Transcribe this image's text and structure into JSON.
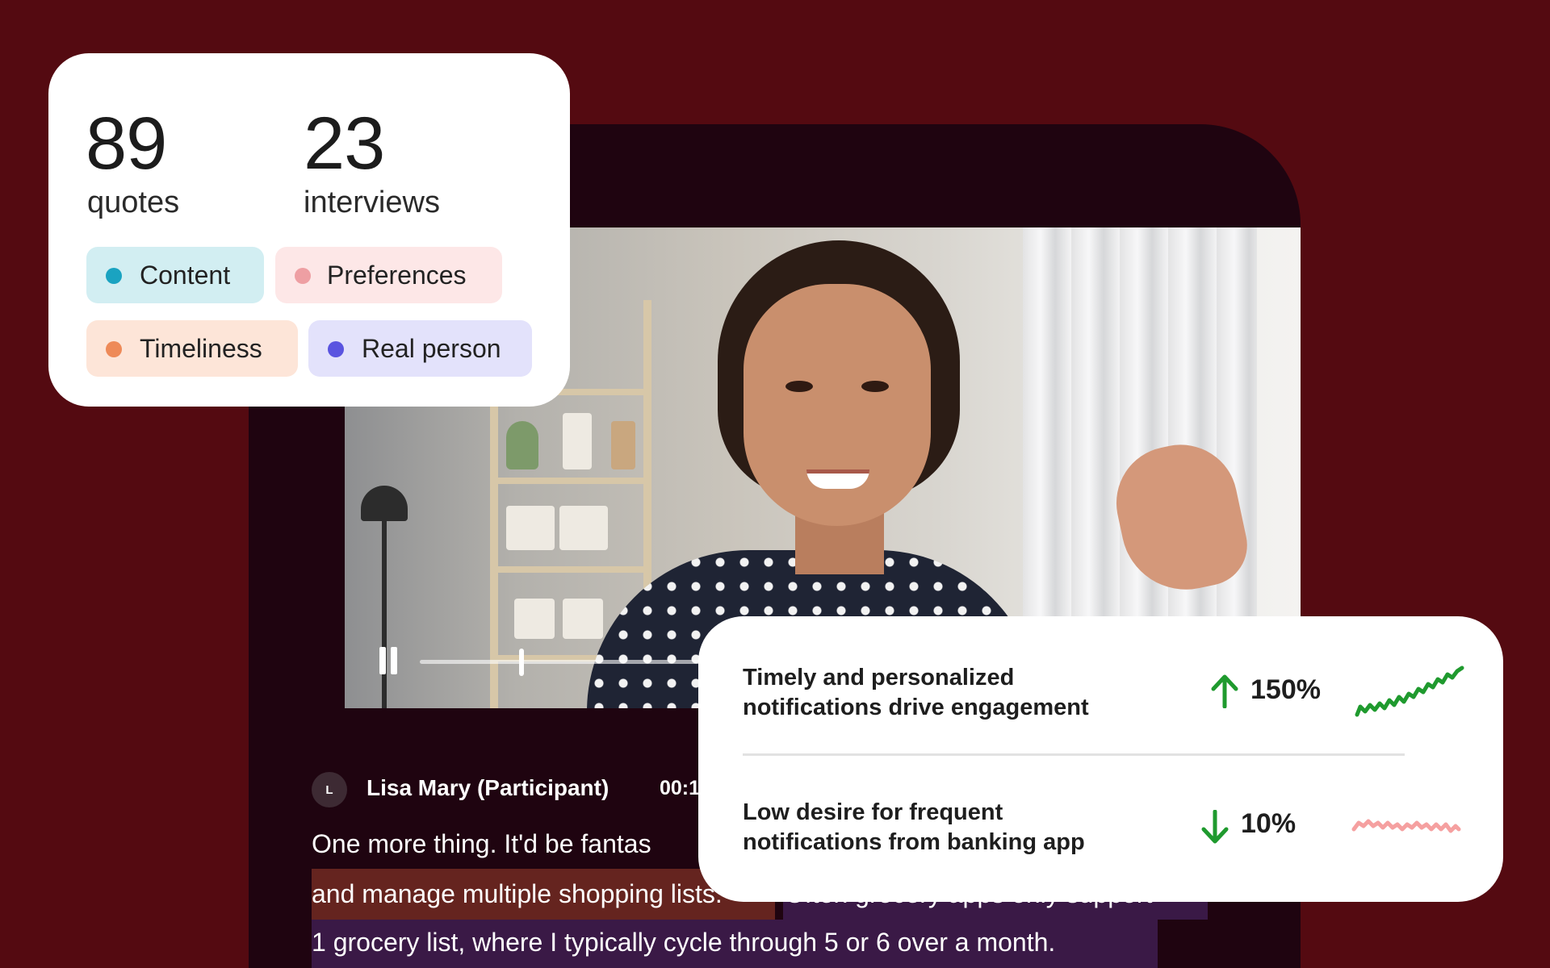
{
  "stats": {
    "quotes_count": "89",
    "quotes_label": "quotes",
    "interviews_count": "23",
    "interviews_label": "interviews"
  },
  "tags": [
    {
      "label": "Content",
      "bg": "#d2eef2",
      "dot": "#1aa3c1"
    },
    {
      "label": "Preferences",
      "bg": "#fde7e7",
      "dot": "#ee9fa3"
    },
    {
      "label": "Timeliness",
      "bg": "#fde5d8",
      "dot": "#ee8a58"
    },
    {
      "label": "Real person",
      "bg": "#e3e2fb",
      "dot": "#5a54e0"
    }
  ],
  "player": {
    "progress": 0.3
  },
  "transcript": {
    "avatar_initial": "L",
    "speaker": "Lisa Mary (Participant)",
    "timestamp": "00:1",
    "line1": "One more thing. It'd be fantas",
    "line2_highlight_orange": "and manage multiple shopping lists.",
    "line2_highlight_purple": "Often grocery apps only support",
    "line3": "1 grocery list, where I typically cycle through 5 or 6 over a month."
  },
  "insights": [
    {
      "title_line1": "Timely and personalized",
      "title_line2": "notifications drive engagement",
      "direction": "up",
      "percent": "150%",
      "color": "#1f9a2e"
    },
    {
      "title_line1": "Low desire for frequent",
      "title_line2": "notifications from banking app",
      "direction": "down",
      "percent": "10%",
      "color": "#1f9a2e",
      "spark_color": "#f5a0a0"
    }
  ],
  "colors": {
    "background": "#540a11",
    "app_frame": "#1f0410",
    "highlight_orange": "#65241f",
    "highlight_purple": "#3a1946"
  }
}
